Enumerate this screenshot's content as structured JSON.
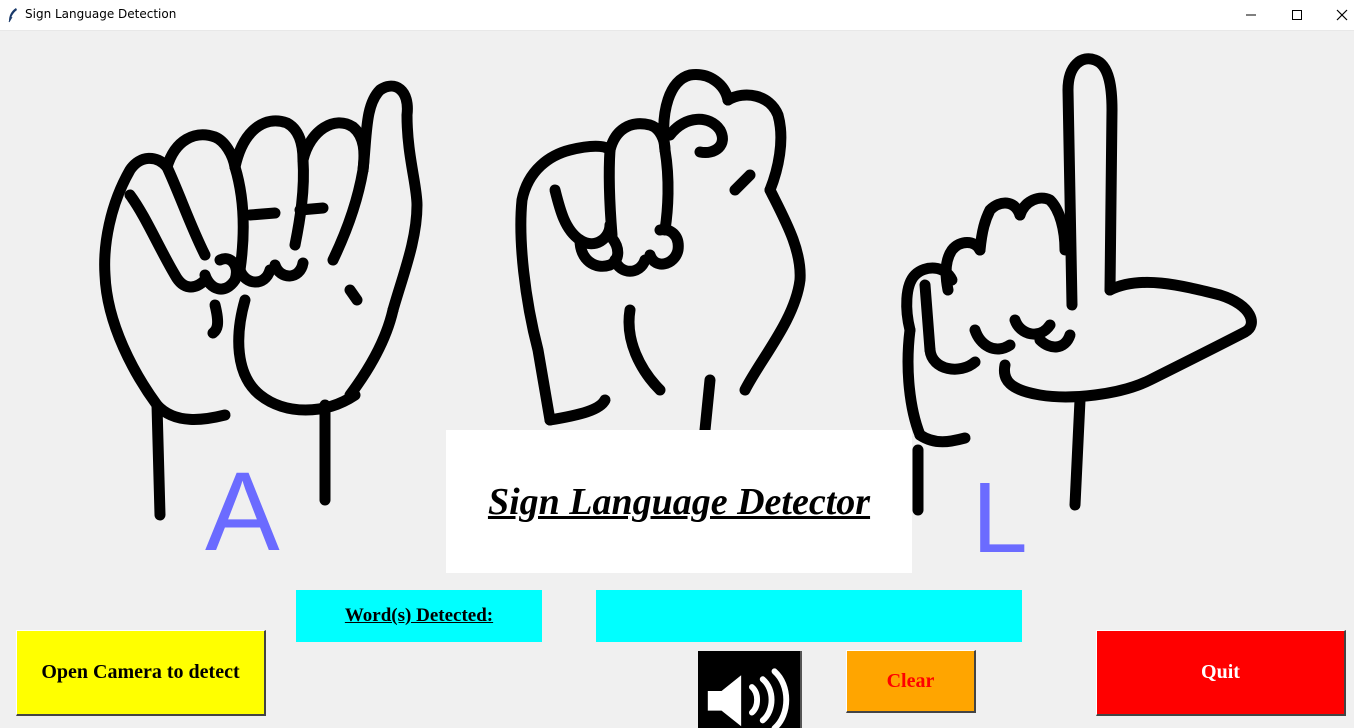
{
  "window": {
    "title": "Sign Language Detection"
  },
  "signs": {
    "left_letter": "A",
    "right_letter": "L"
  },
  "header": {
    "title": "Sign Language Detector"
  },
  "detection": {
    "label": "Word(s) Detected:",
    "value": ""
  },
  "buttons": {
    "open_camera": "Open Camera to detect",
    "clear": "Clear",
    "quit": "Quit",
    "speak_icon": "speaker-icon"
  },
  "colors": {
    "background": "#f0f0f0",
    "letter": "#6b6bff",
    "label_bg": "#00ffff",
    "open_camera_bg": "#ffff00",
    "clear_bg": "#ffa500",
    "clear_text": "#ff0000",
    "quit_bg": "#ff0000",
    "quit_text": "#ffffff"
  }
}
